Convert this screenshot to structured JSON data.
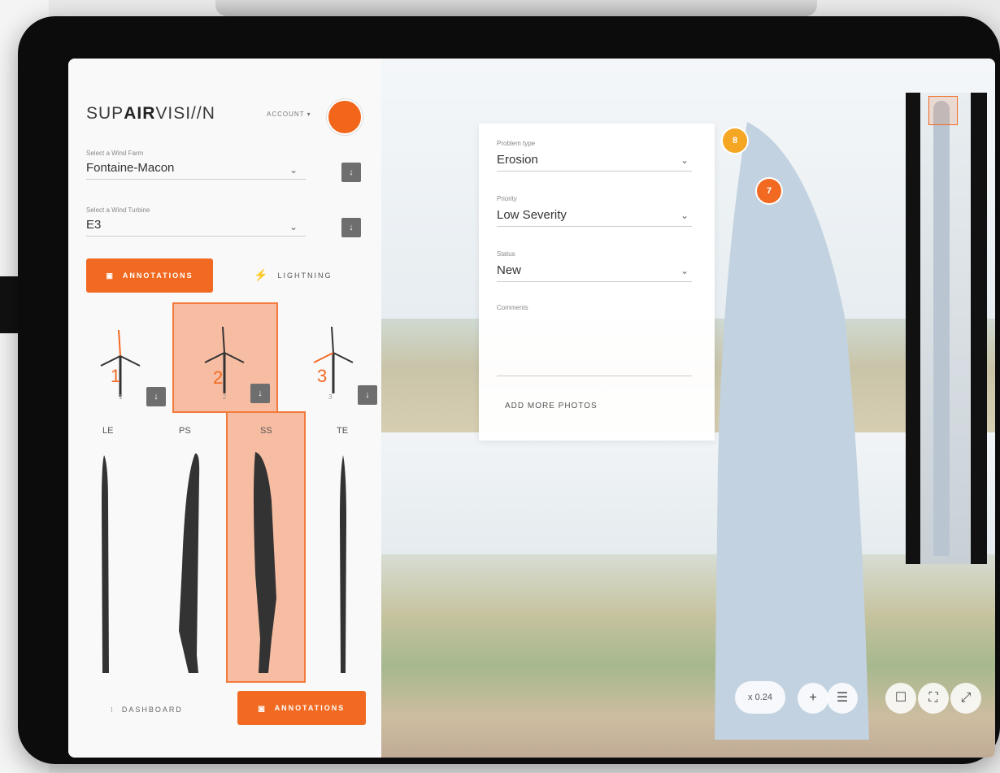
{
  "brand": {
    "prefix": "SUP",
    "bold": "AIR",
    "suffix": "VISI//N"
  },
  "account_label": "ACCOUNT ▾",
  "sidebar": {
    "wind_farm": {
      "label": "Select a Wind Farm",
      "value": "Fontaine-Macon"
    },
    "wind_turbine": {
      "label": "Select a Wind Turbine",
      "value": "E3"
    },
    "tabs": {
      "annotations": "ANNOTATIONS",
      "lightning": "LIGHTNING"
    },
    "turbines": [
      {
        "number": "1",
        "sub": "1"
      },
      {
        "number": "2",
        "sub": "2"
      },
      {
        "number": "3",
        "sub": "3"
      }
    ],
    "selected_turbine": "2",
    "blade_sides": [
      "LE",
      "PS",
      "SS",
      "TE"
    ],
    "selected_side": "SS",
    "bottom": {
      "dashboard": "DASHBOARD",
      "annotations": "ANNOTATIONS"
    }
  },
  "annotation_panel": {
    "problem_type": {
      "label": "Problem type",
      "value": "Erosion"
    },
    "priority": {
      "label": "Priority",
      "value": "Low Severity"
    },
    "status": {
      "label": "Status",
      "value": "New"
    },
    "comments_label": "Comments",
    "add_photos": "ADD MORE PHOTOS"
  },
  "markers": [
    {
      "label": "8",
      "color": "#f5a623"
    },
    {
      "label": "7",
      "color": "#f26a22"
    }
  ],
  "zoom_level": "x 0.24",
  "tools": {
    "plus": "+",
    "list": "☰",
    "square": "☐",
    "fit": "⛶",
    "fullscreen": "⤢"
  },
  "colors": {
    "accent": "#f26a22",
    "highlight": "#f6b08c"
  }
}
